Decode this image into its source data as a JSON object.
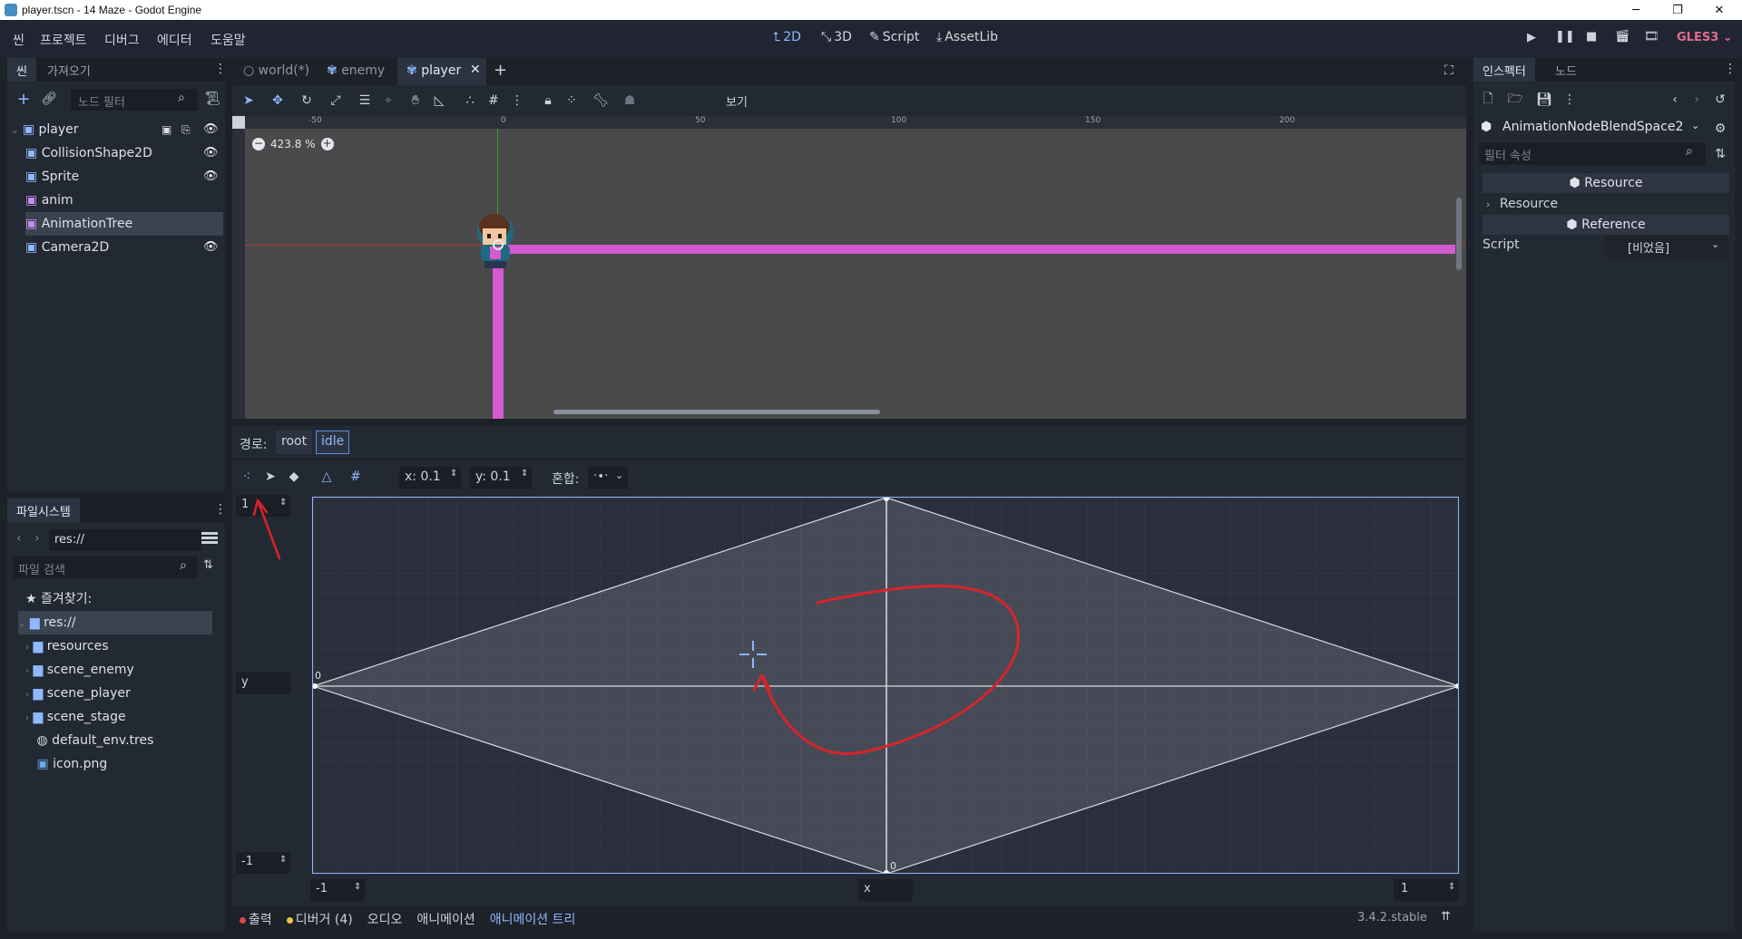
{
  "titlebar": {
    "title": "player.tscn - 14 Maze - Godot Engine"
  },
  "menu": [
    "씬",
    "프로젝트",
    "디버그",
    "에디터",
    "도움말"
  ],
  "modes": [
    {
      "icon": "2d-icon",
      "label": "2D"
    },
    {
      "icon": "3d-icon",
      "label": "3D"
    },
    {
      "icon": "script-icon",
      "label": "Script"
    },
    {
      "icon": "assetlib-icon",
      "label": "AssetLib"
    }
  ],
  "renderer": "GLES3",
  "scene_dock": {
    "tabs": [
      "씬",
      "가져오기"
    ],
    "filter_placeholder": "노드 필터",
    "nodes": [
      {
        "name": "player",
        "icon": "kinematic-icon",
        "color": "#8fb8ff"
      },
      {
        "name": "CollisionShape2D",
        "icon": "collision-icon",
        "color": "#8fb8ff"
      },
      {
        "name": "Sprite",
        "icon": "sprite-icon",
        "color": "#8fb8ff"
      },
      {
        "name": "anim",
        "icon": "animation-player-icon",
        "color": "#c38ef1"
      },
      {
        "name": "AnimationTree",
        "icon": "animation-tree-icon",
        "color": "#c38ef1"
      },
      {
        "name": "Camera2D",
        "icon": "camera-icon",
        "color": "#8fb8ff"
      }
    ]
  },
  "filesystem": {
    "title": "파일시스템",
    "path": "res://",
    "search_placeholder": "파일 검색",
    "favorites": "즐겨찾기:",
    "root": "res://",
    "items": [
      "resources",
      "scene_enemy",
      "scene_player",
      "scene_stage",
      "default_env.tres",
      "icon.png"
    ]
  },
  "editor_tabs": [
    {
      "label": "world(*)"
    },
    {
      "label": "enemy"
    },
    {
      "label": "player"
    }
  ],
  "viewport": {
    "view_menu": "보기",
    "zoom": "423.8 %",
    "ruler_labels": [
      "-50",
      "0",
      "50",
      "100",
      "150",
      "200"
    ]
  },
  "blend": {
    "path_label": "경로:",
    "path": [
      "root",
      "idle"
    ],
    "snap_x": "x: 0.1",
    "snap_y": "y: 0.1",
    "blend_label": "혼합:",
    "blend_value": "·∙·",
    "max_y": "1",
    "min_y": "-1",
    "y_label": "y",
    "x_label": "x",
    "min_x": "-1",
    "max_x": "1",
    "zero_left": "0",
    "zero_bottom": "0"
  },
  "bottom_tabs": [
    {
      "label": "출력",
      "dot": "#e04545"
    },
    {
      "label": "디버거 (4)",
      "dot": "#f2c14e"
    },
    {
      "label": "오디오",
      "dot": ""
    },
    {
      "label": "애니메이션",
      "dot": ""
    },
    {
      "label": "애니메이션 트리",
      "dot": ""
    }
  ],
  "version": "3.4.2.stable",
  "inspector": {
    "tabs": [
      "인스펙터",
      "노드"
    ],
    "resource_name": "AnimationNodeBlendSpace2",
    "filter_placeholder": "필터 속성",
    "section_resource": "Resource",
    "subsection_resource": "Resource",
    "section_reference": "Reference",
    "script_label": "Script",
    "script_value": "[비었음]"
  }
}
